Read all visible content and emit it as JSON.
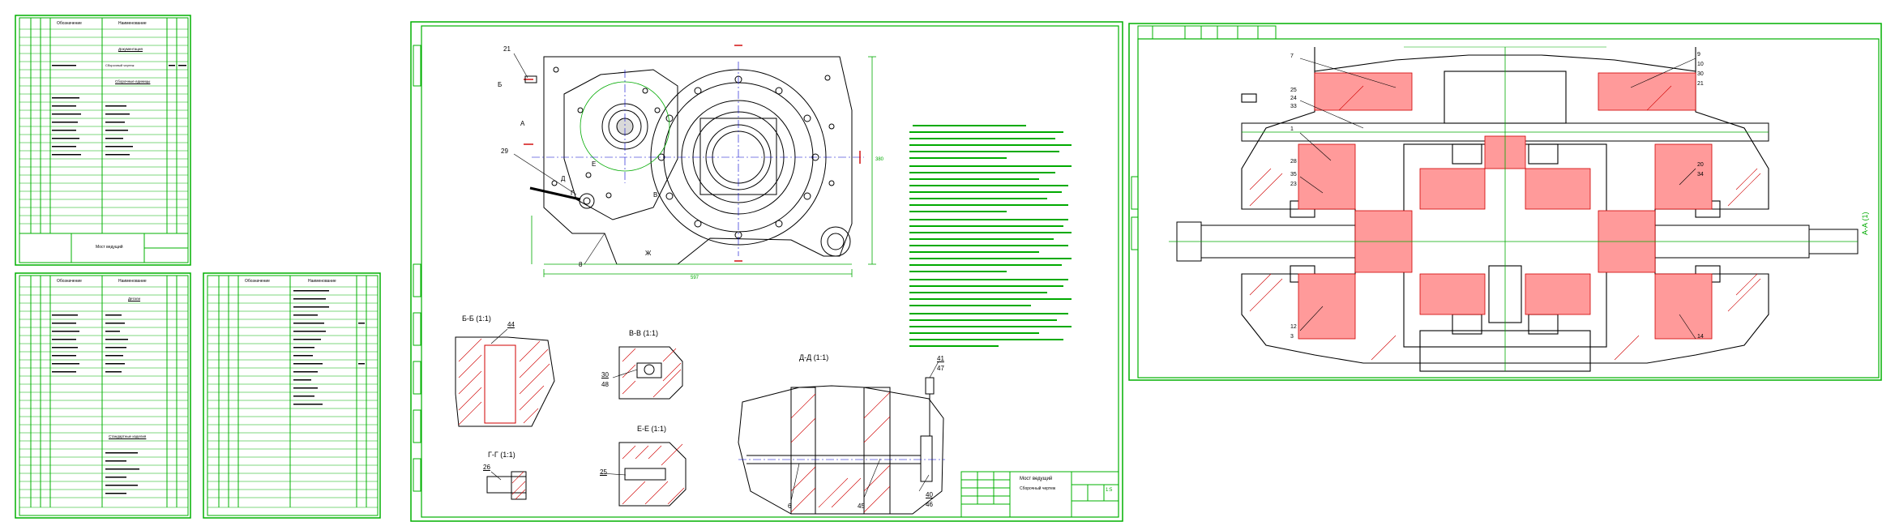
{
  "colors": {
    "frame": "#00b000",
    "outline": "#000000",
    "section": "#d00000",
    "dim": "#00aa00",
    "center": "#0000cc",
    "text": "#000000"
  },
  "spec1": {
    "header": [
      "Обозначение",
      "Наименование"
    ],
    "groups": [
      "Документация",
      "Сборочные единицы"
    ],
    "doc_item": "Сборочный чертеж",
    "title": "Мост ведущий"
  },
  "spec2": {
    "header": [
      "Обозначение",
      "Наименование"
    ],
    "groups": [
      "Детали",
      "Стандартные изделия"
    ]
  },
  "spec3": {
    "header": [
      "Обозначение",
      "Наименование"
    ]
  },
  "drawing": {
    "labels_small": [
      "21",
      "29",
      "8",
      "Б",
      "А",
      "Д",
      "Г",
      "Е",
      "В",
      "Ж"
    ],
    "sections": {
      "bb": "Б-Б (1:1)",
      "vv": "В-В (1:1)",
      "dd": "Д-Д (1:1)",
      "ee": "Е-Е (1:1)",
      "gg": "Г-Г (1:1)"
    },
    "leaders": [
      "44",
      "30",
      "48",
      "26",
      "25",
      "41",
      "47",
      "6",
      "45",
      "40",
      "46"
    ],
    "dims": [
      "597",
      "380"
    ],
    "title_block": {
      "name": "Мост ведущий",
      "doc": "Сборочный чертеж",
      "sheet": "1:5"
    }
  },
  "view": {
    "section_label": "А-А (1)",
    "leaders_left": [
      "7",
      "25",
      "24",
      "33",
      "1",
      "28",
      "35",
      "23",
      "12",
      "3"
    ],
    "leaders_right": [
      "9",
      "10",
      "30",
      "21",
      "20",
      "34",
      "14"
    ]
  }
}
